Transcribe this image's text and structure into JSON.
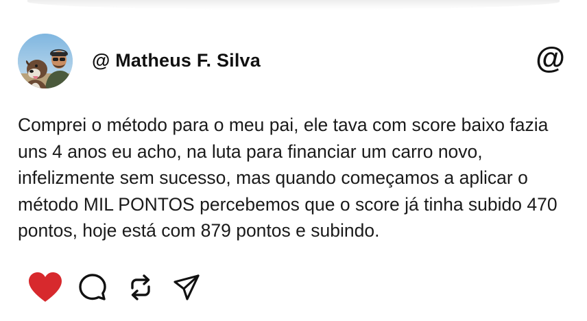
{
  "post": {
    "username": "@ Matheus F. Silva",
    "mention_icon": "@",
    "text": "Comprei o método para o meu pai, ele tava com score baixo fazia uns 4 anos eu acho, na luta para financiar um carro novo, infelizmente sem sucesso, mas quando começamos a aplicar o método MIL PONTOS percebemos que o score já tinha subido 470 pontos, hoje está com 879 pontos e subindo."
  },
  "actions": {
    "icons": [
      "heart-icon",
      "comment-icon",
      "repost-icon",
      "share-icon"
    ]
  },
  "colors": {
    "heart": "#d7292d",
    "text": "#1a1a1a",
    "icon_stroke": "#111111",
    "background": "#ffffff"
  }
}
